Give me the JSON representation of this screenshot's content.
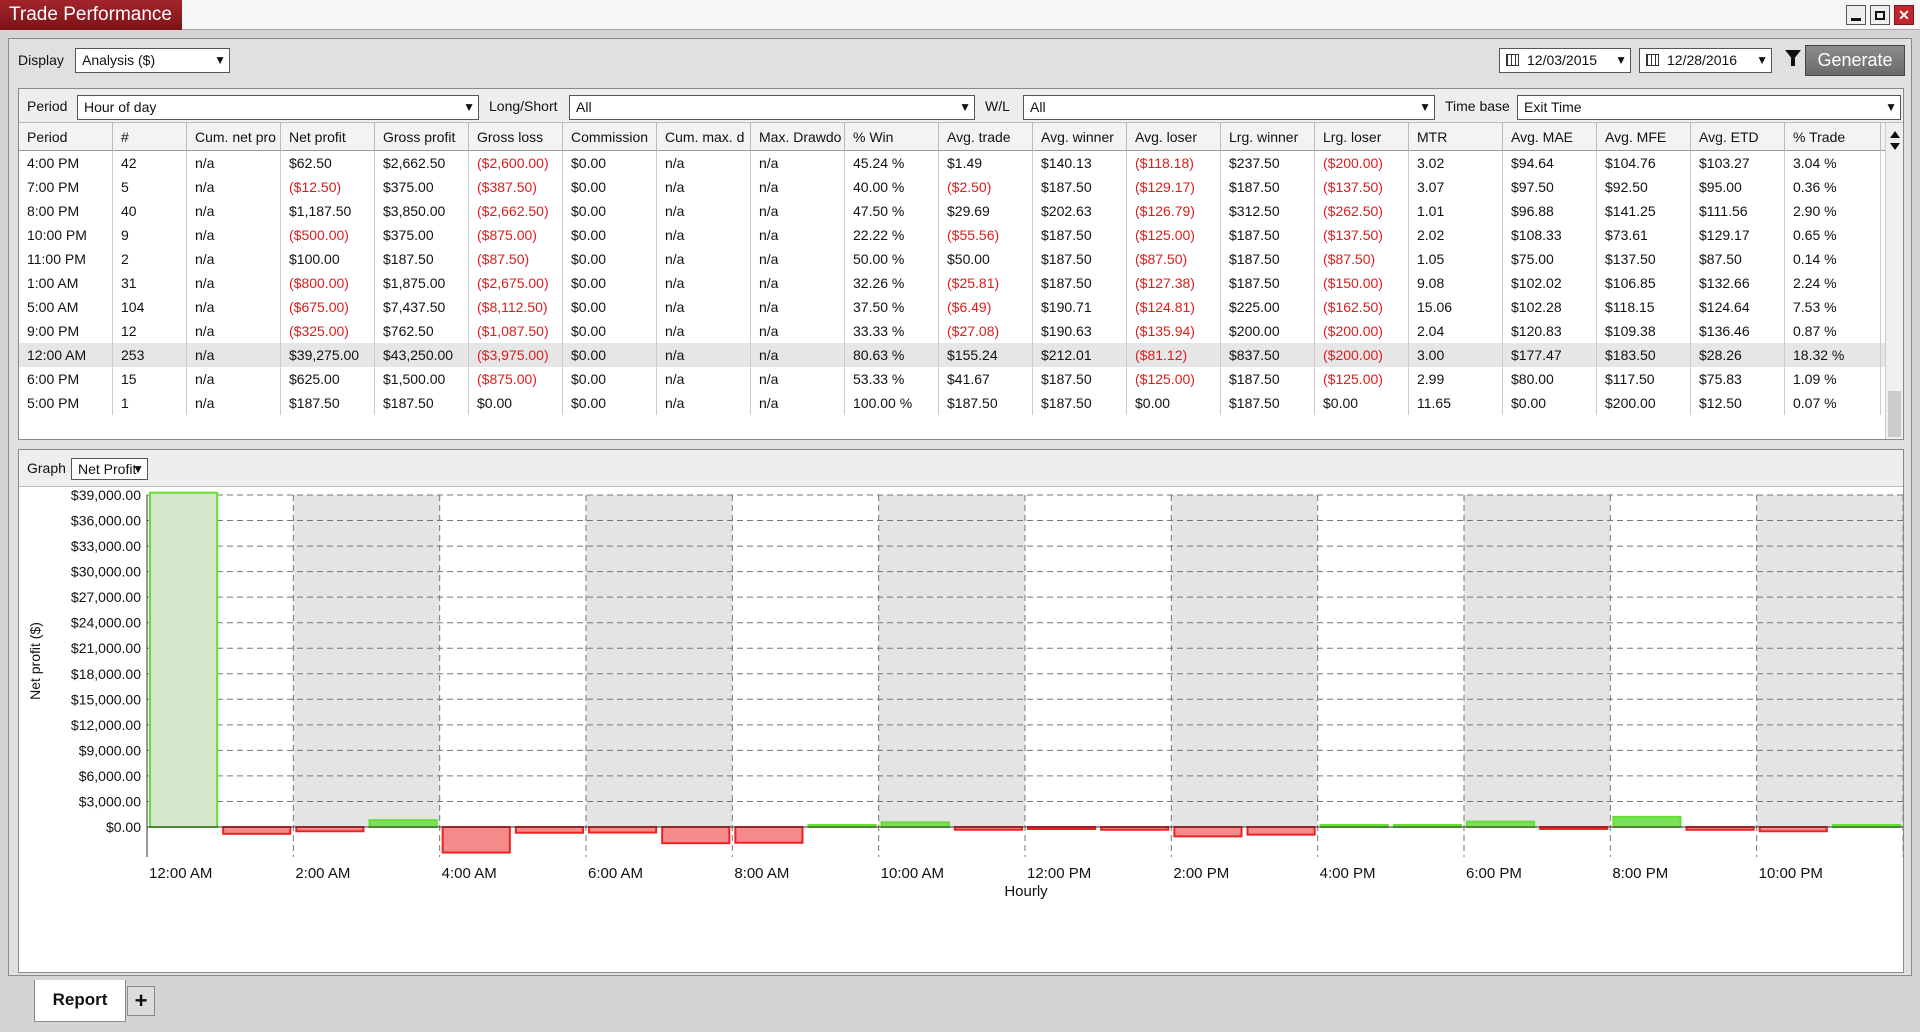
{
  "window": {
    "title": "Trade Performance",
    "buttons": [
      "minimize",
      "restore",
      "close"
    ]
  },
  "toolbar": {
    "display_label": "Display",
    "display_value": "Analysis ($)",
    "start_date": "12/03/2015",
    "end_date": "12/28/2016",
    "generate_label": "Generate"
  },
  "filters": {
    "period_label": "Period",
    "period_value": "Hour of day",
    "longshort_label": "Long/Short",
    "longshort_value": "All",
    "wl_label": "W/L",
    "wl_value": "All",
    "timebase_label": "Time base",
    "timebase_value": "Exit Time"
  },
  "grid": {
    "columns": [
      "Period",
      "#",
      "Cum. net pro",
      "Net profit",
      "Gross profit",
      "Gross loss",
      "Commission",
      "Cum. max. d",
      "Max. Drawdo",
      "% Win",
      "Avg. trade",
      "Avg. winner",
      "Avg. loser",
      "Lrg. winner",
      "Lrg. loser",
      "MTR",
      "Avg. MAE",
      "Avg. MFE",
      "Avg. ETD",
      "% Trade"
    ],
    "selected_row": 8,
    "rows": [
      [
        "4:00 PM",
        "42",
        "n/a",
        "$62.50",
        "$2,662.50",
        "($2,600.00)",
        "$0.00",
        "n/a",
        "n/a",
        "45.24 %",
        "$1.49",
        "$140.13",
        "($118.18)",
        "$237.50",
        "($200.00)",
        "3.02",
        "$94.64",
        "$104.76",
        "$103.27",
        "3.04 %"
      ],
      [
        "7:00 PM",
        "5",
        "n/a",
        "($12.50)",
        "$375.00",
        "($387.50)",
        "$0.00",
        "n/a",
        "n/a",
        "40.00 %",
        "($2.50)",
        "$187.50",
        "($129.17)",
        "$187.50",
        "($137.50)",
        "3.07",
        "$97.50",
        "$92.50",
        "$95.00",
        "0.36 %"
      ],
      [
        "8:00 PM",
        "40",
        "n/a",
        "$1,187.50",
        "$3,850.00",
        "($2,662.50)",
        "$0.00",
        "n/a",
        "n/a",
        "47.50 %",
        "$29.69",
        "$202.63",
        "($126.79)",
        "$312.50",
        "($262.50)",
        "1.01",
        "$96.88",
        "$141.25",
        "$111.56",
        "2.90 %"
      ],
      [
        "10:00 PM",
        "9",
        "n/a",
        "($500.00)",
        "$375.00",
        "($875.00)",
        "$0.00",
        "n/a",
        "n/a",
        "22.22 %",
        "($55.56)",
        "$187.50",
        "($125.00)",
        "$187.50",
        "($137.50)",
        "2.02",
        "$108.33",
        "$73.61",
        "$129.17",
        "0.65 %"
      ],
      [
        "11:00 PM",
        "2",
        "n/a",
        "$100.00",
        "$187.50",
        "($87.50)",
        "$0.00",
        "n/a",
        "n/a",
        "50.00 %",
        "$50.00",
        "$187.50",
        "($87.50)",
        "$187.50",
        "($87.50)",
        "1.05",
        "$75.00",
        "$137.50",
        "$87.50",
        "0.14 %"
      ],
      [
        "1:00 AM",
        "31",
        "n/a",
        "($800.00)",
        "$1,875.00",
        "($2,675.00)",
        "$0.00",
        "n/a",
        "n/a",
        "32.26 %",
        "($25.81)",
        "$187.50",
        "($127.38)",
        "$187.50",
        "($150.00)",
        "9.08",
        "$102.02",
        "$106.85",
        "$132.66",
        "2.24 %"
      ],
      [
        "5:00 AM",
        "104",
        "n/a",
        "($675.00)",
        "$7,437.50",
        "($8,112.50)",
        "$0.00",
        "n/a",
        "n/a",
        "37.50 %",
        "($6.49)",
        "$190.71",
        "($124.81)",
        "$225.00",
        "($162.50)",
        "15.06",
        "$102.28",
        "$118.15",
        "$124.64",
        "7.53 %"
      ],
      [
        "9:00 PM",
        "12",
        "n/a",
        "($325.00)",
        "$762.50",
        "($1,087.50)",
        "$0.00",
        "n/a",
        "n/a",
        "33.33 %",
        "($27.08)",
        "$190.63",
        "($135.94)",
        "$200.00",
        "($200.00)",
        "2.04",
        "$120.83",
        "$109.38",
        "$136.46",
        "0.87 %"
      ],
      [
        "12:00 AM",
        "253",
        "n/a",
        "$39,275.00",
        "$43,250.00",
        "($3,975.00)",
        "$0.00",
        "n/a",
        "n/a",
        "80.63 %",
        "$155.24",
        "$212.01",
        "($81.12)",
        "$837.50",
        "($200.00)",
        "3.00",
        "$177.47",
        "$183.50",
        "$28.26",
        "18.32 %"
      ],
      [
        "6:00 PM",
        "15",
        "n/a",
        "$625.00",
        "$1,500.00",
        "($875.00)",
        "$0.00",
        "n/a",
        "n/a",
        "53.33 %",
        "$41.67",
        "$187.50",
        "($125.00)",
        "$187.50",
        "($125.00)",
        "2.99",
        "$80.00",
        "$117.50",
        "$75.83",
        "1.09 %"
      ],
      [
        "5:00 PM",
        "1",
        "n/a",
        "$187.50",
        "$187.50",
        "$0.00",
        "$0.00",
        "n/a",
        "n/a",
        "100.00 %",
        "$187.50",
        "$187.50",
        "$0.00",
        "$187.50",
        "$0.00",
        "11.65",
        "$0.00",
        "$200.00",
        "$12.50",
        "0.07 %"
      ]
    ]
  },
  "graph": {
    "label": "Graph",
    "value": "Net Profit"
  },
  "chart_data": {
    "type": "bar",
    "title": "",
    "ylabel": "Net profit ($)",
    "xlabel": "Hourly",
    "ylim": [
      0,
      39000
    ],
    "yticks": [
      "$39,000.00",
      "$36,000.00",
      "$33,000.00",
      "$30,000.00",
      "$27,000.00",
      "$24,000.00",
      "$21,000.00",
      "$18,000.00",
      "$15,000.00",
      "$12,000.00",
      "$9,000.00",
      "$6,000.00",
      "$3,000.00",
      "$0.00"
    ],
    "ytick_values": [
      39000,
      36000,
      33000,
      30000,
      27000,
      24000,
      21000,
      18000,
      15000,
      12000,
      9000,
      6000,
      3000,
      0
    ],
    "xtick_labels": [
      "12:00 AM",
      "2:00 AM",
      "4:00 AM",
      "6:00 AM",
      "8:00 AM",
      "10:00 AM",
      "12:00 PM",
      "2:00 PM",
      "4:00 PM",
      "6:00 PM",
      "8:00 PM",
      "10:00 PM"
    ],
    "categories": [
      "12:00 AM",
      "1:00 AM",
      "2:00 AM",
      "3:00 AM",
      "4:00 AM",
      "5:00 AM",
      "6:00 AM",
      "7:00 AM",
      "8:00 AM",
      "9:00 AM",
      "10:00 AM",
      "11:00 AM",
      "12:00 PM",
      "1:00 PM",
      "2:00 PM",
      "3:00 PM",
      "4:00 PM",
      "5:00 PM",
      "6:00 PM",
      "7:00 PM",
      "8:00 PM",
      "9:00 PM",
      "10:00 PM",
      "11:00 PM"
    ],
    "values": [
      39275,
      -800,
      -500,
      800,
      -3000,
      -675,
      -650,
      -1900,
      -1850,
      100,
      550,
      -325,
      -150,
      -325,
      -1100,
      -900,
      62.5,
      187.5,
      625,
      -12.5,
      1187.5,
      -325,
      -500,
      100
    ],
    "positive_color": "#66dd33",
    "negative_color": "#ee2222",
    "grid": true
  }
}
